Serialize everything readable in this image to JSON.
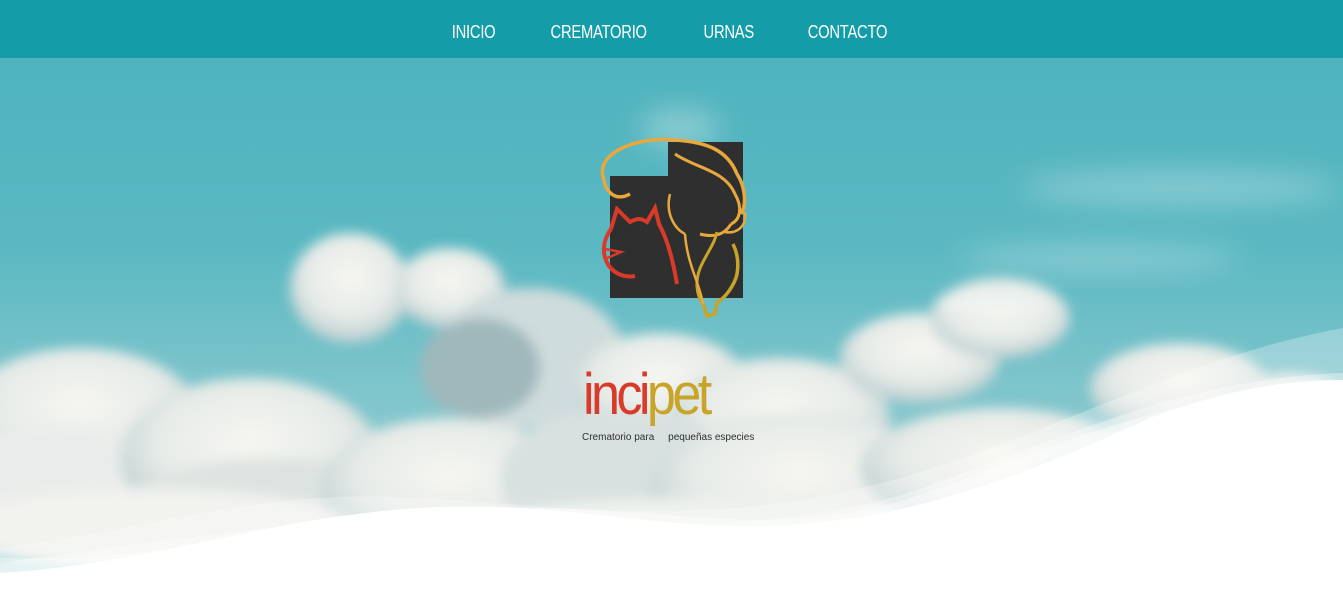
{
  "nav": {
    "items": [
      {
        "label": "INICIO"
      },
      {
        "label": "CREMATORIO"
      },
      {
        "label": "URNAS"
      },
      {
        "label": "CONTACTO"
      }
    ]
  },
  "hero": {
    "logo": {
      "word_part1": "inci",
      "word_part2": "pet",
      "tagline": "Crematorio para     pequeñas especies"
    },
    "icons": {
      "logo": "pet-silhouette-logo-icon"
    }
  },
  "colors": {
    "nav_bg": "#149ca8",
    "sky": "#5ab8c2",
    "logo_red": "#d93a2a",
    "logo_gold": "#c8a52a",
    "logo_dark": "#2f2f2f"
  }
}
